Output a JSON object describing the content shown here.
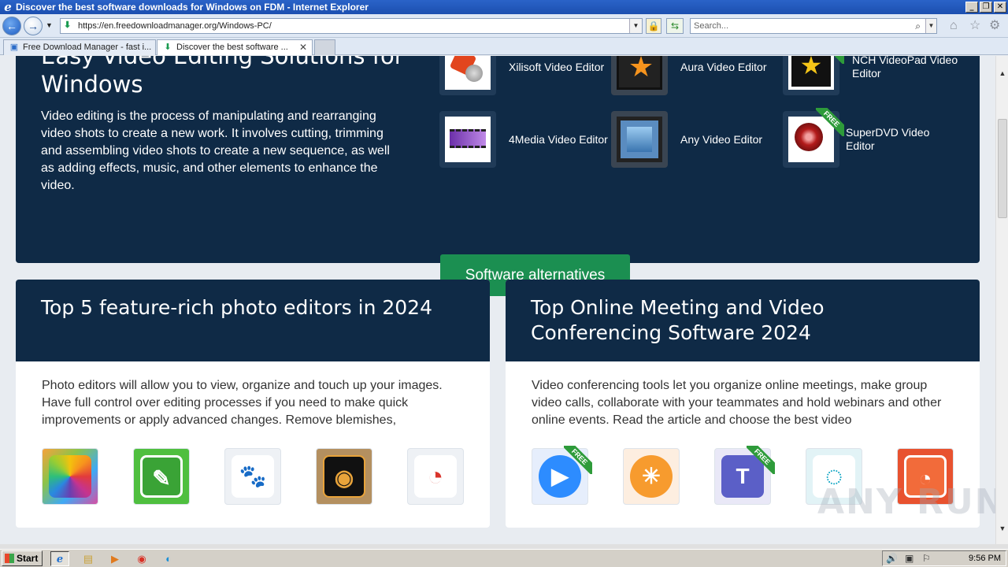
{
  "window": {
    "title": "Discover the best software downloads for Windows on FDM - Internet Explorer",
    "min": "_",
    "max": "❐",
    "close": "✕"
  },
  "nav": {
    "address": "https://en.freedownloadmanager.org/Windows-PC/",
    "search_placeholder": "Search..."
  },
  "tabs": [
    {
      "label": "Free Download Manager - fast i..."
    },
    {
      "label": "Discover the best software ...",
      "close": "✕"
    }
  ],
  "hero": {
    "title": "Easy Video Editing Solutions for Windows",
    "description": "Video editing is the process of manipulating and rearranging video shots to create a new work. It involves cutting, trimming and assembling video shots to create a new sequence, as well as adding effects, music, and other elements to enhance the video.",
    "apps": [
      {
        "name": "Xilisoft Video Editor"
      },
      {
        "name": "Aura Video Editor"
      },
      {
        "name": "NCH VideoPad Video Editor",
        "badge": "FREE"
      },
      {
        "name": "4Media Video Editor"
      },
      {
        "name": "Any Video Editor"
      },
      {
        "name": "SuperDVD Video Editor",
        "badge": "FREE"
      }
    ],
    "cta": "Software alternatives"
  },
  "cards": [
    {
      "title": "Top 5 feature-rich photo editors in 2024",
      "body": "Photo editors will allow you to view, organize and touch up your images. Have full control over editing processes if you need to make quick improvements or apply advanced changes. Remove blemishes,"
    },
    {
      "title": "Top Online Meeting and Video Conferencing Software 2024",
      "body": "Video conferencing tools let you organize online meetings, make group video calls, collaborate with your teammates and hold webinars and other online events. Read the article and choose the best video",
      "badges": [
        "FREE",
        "FREE"
      ]
    }
  ],
  "taskbar": {
    "start": "Start",
    "clock": "9:56 PM"
  },
  "watermark": "ANY RUN"
}
